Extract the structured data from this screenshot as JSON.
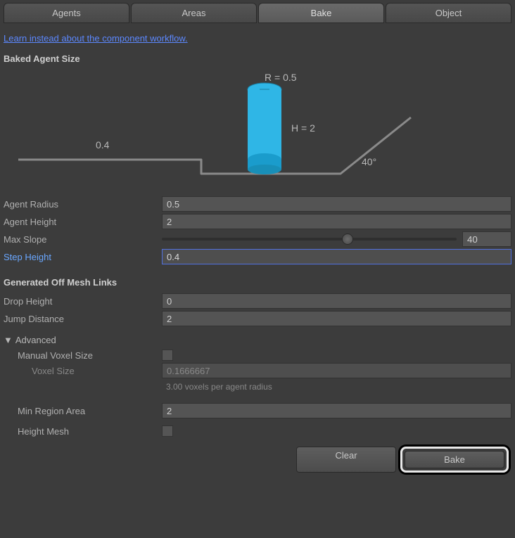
{
  "tabs": [
    "Agents",
    "Areas",
    "Bake",
    "Object"
  ],
  "active_tab_index": 2,
  "link_text": "Learn instead about the component workflow.",
  "sections": {
    "baked_agent_size": "Baked Agent Size",
    "off_mesh_links": "Generated Off Mesh Links",
    "advanced": "Advanced"
  },
  "diagram": {
    "radius_label": "R = 0.5",
    "height_label": "H = 2",
    "step_label": "0.4",
    "slope_label": "40°"
  },
  "fields": {
    "agent_radius": {
      "label": "Agent Radius",
      "value": "0.5"
    },
    "agent_height": {
      "label": "Agent Height",
      "value": "2"
    },
    "max_slope": {
      "label": "Max Slope",
      "value": "40",
      "slider_percent": 63
    },
    "step_height": {
      "label": "Step Height",
      "value": "0.4"
    },
    "drop_height": {
      "label": "Drop Height",
      "value": "0"
    },
    "jump_distance": {
      "label": "Jump Distance",
      "value": "2"
    },
    "manual_voxel": {
      "label": "Manual Voxel Size",
      "checked": false
    },
    "voxel_size": {
      "label": "Voxel Size",
      "value": "0.1666667",
      "hint": "3.00 voxels per agent radius"
    },
    "min_region_area": {
      "label": "Min Region Area",
      "value": "2"
    },
    "height_mesh": {
      "label": "Height Mesh",
      "checked": false
    }
  },
  "buttons": {
    "clear": "Clear",
    "bake": "Bake"
  }
}
